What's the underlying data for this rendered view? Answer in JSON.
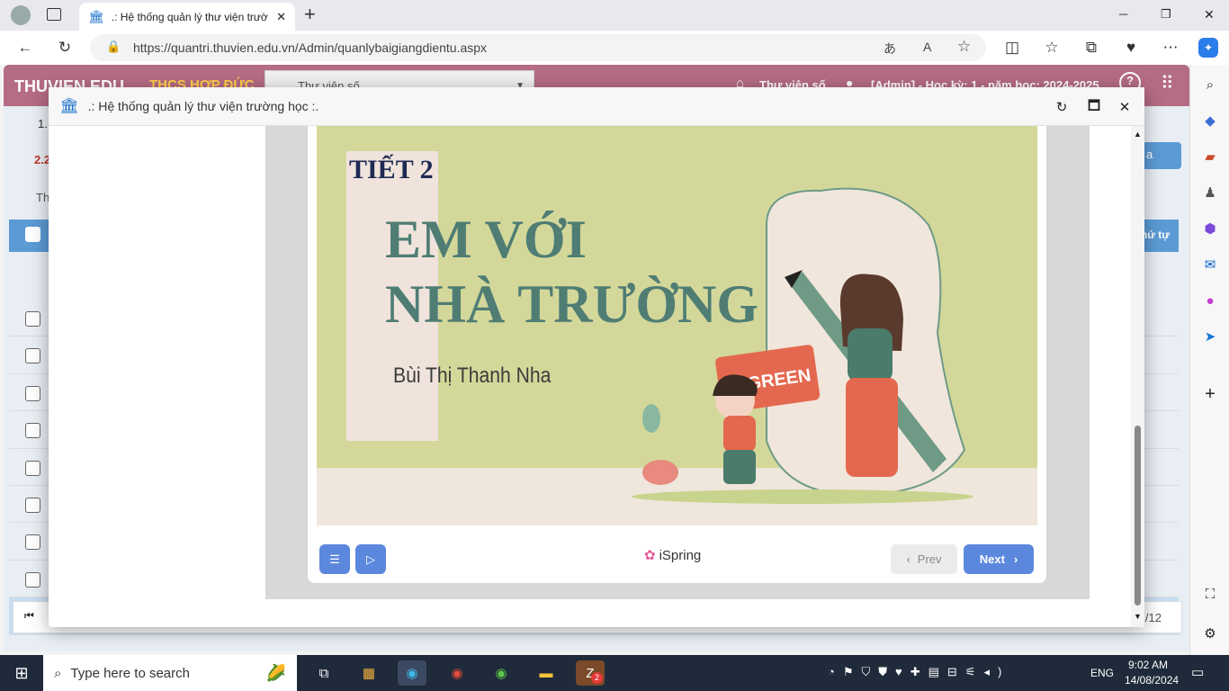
{
  "browser": {
    "tab_title": ".: Hệ thống quản lý thư viện trườ",
    "url": "https://quantri.thuvien.edu.vn/Admin/quanlybaigiangdientu.aspx",
    "new_tab": "+",
    "window_controls": {
      "minimize": "─",
      "restore": "❐",
      "close": "✕"
    }
  },
  "app": {
    "logo": "THUVIEN.EDU",
    "school": "THCS HỢP ĐỨC",
    "library_select": "Thư viện số",
    "library_link": "Thư viện số",
    "admin_info": "[Admin] - Học kỳ: 1 - năm học: 2024-2025",
    "breadcrumb_1": "1.",
    "breadcrumb_2": "2.2",
    "filter_label": "Th",
    "col_order": "Thứ tự",
    "action_button": "a",
    "pager_count": "12/12",
    "rows": [
      {
        "checked": false
      },
      {
        "checked": false
      },
      {
        "checked": false
      },
      {
        "checked": false
      },
      {
        "checked": false
      },
      {
        "checked": false
      },
      {
        "checked": false
      },
      {
        "checked": false
      },
      {
        "checked": true
      }
    ]
  },
  "dialog": {
    "title": ".: Hệ thống quản lý thư viện trường học :.",
    "reload_icon": "↻",
    "maximize_icon": "🗖",
    "close_icon": "✕"
  },
  "slide": {
    "lesson": "TIẾT 2",
    "title_line1": "EM VỚI",
    "title_line2": "NHÀ TRƯỜNG",
    "author": "Bùi Thị Thanh Nha",
    "puzzle_text": "GREEN"
  },
  "player": {
    "brand": "iSpring",
    "prev_label": "Prev",
    "next_label": "Next"
  },
  "taskbar": {
    "search_placeholder": "Type here to search",
    "language": "ENG",
    "time": "9:02 AM",
    "date": "14/08/2024",
    "zalo_badge": "2"
  },
  "colors": {
    "app_header": "#b56c85",
    "slide_bg": "#d3d89a",
    "title_color": "#4f7d74",
    "next_button": "#5b88dd"
  }
}
